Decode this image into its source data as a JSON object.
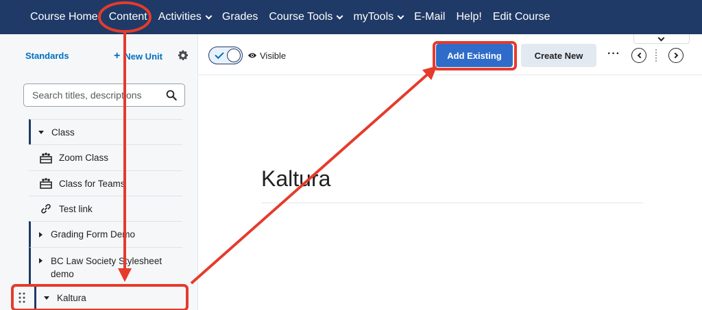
{
  "topnav": {
    "items": [
      {
        "label": "Course Home",
        "dropdown": false
      },
      {
        "label": "Content",
        "dropdown": false
      },
      {
        "label": "Activities",
        "dropdown": true
      },
      {
        "label": "Grades",
        "dropdown": false
      },
      {
        "label": "Course Tools",
        "dropdown": true
      },
      {
        "label": "myTools",
        "dropdown": true
      },
      {
        "label": "E-Mail",
        "dropdown": false
      },
      {
        "label": "Help!",
        "dropdown": false
      },
      {
        "label": "Edit Course",
        "dropdown": false
      }
    ]
  },
  "sidebar": {
    "standards_label": "Standards",
    "new_unit_label": "New Unit",
    "search_placeholder": "Search titles, descriptions",
    "tree": [
      {
        "type": "unit-open",
        "label": "Class"
      },
      {
        "type": "topic",
        "icon": "class-icon",
        "label": "Zoom Class"
      },
      {
        "type": "topic",
        "icon": "class-icon",
        "label": "Class for Teams"
      },
      {
        "type": "topic",
        "icon": "link-icon",
        "label": "Test link"
      },
      {
        "type": "unit-closed",
        "label": "Grading Form Demo"
      },
      {
        "type": "unit-closed",
        "label": "BC Law Society Stylesheet demo"
      }
    ],
    "selected_unit": "Kaltura"
  },
  "toolbar": {
    "visible_label": "Visible",
    "add_existing_label": "Add Existing",
    "create_new_label": "Create New",
    "more_label": "···"
  },
  "main": {
    "title": "Kaltura"
  },
  "colors": {
    "nav_bg": "#1f3a66",
    "primary_button": "#2f6cc9",
    "secondary_button": "#e3e9f1",
    "link": "#006fbf",
    "annotation": "#e53b2c"
  }
}
